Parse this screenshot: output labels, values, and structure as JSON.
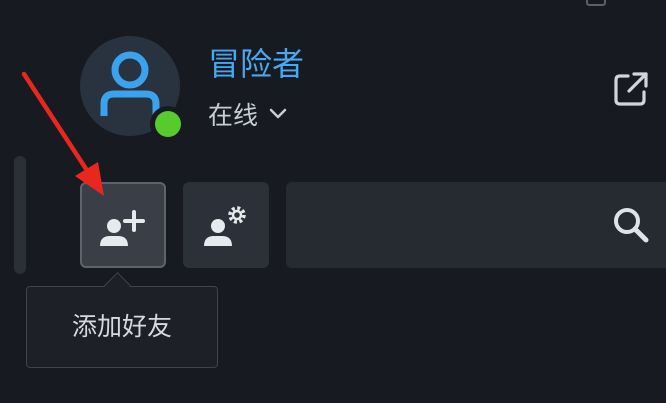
{
  "profile": {
    "username": "冒险者",
    "status_label": "在线"
  },
  "toolbar": {
    "add_friend_tooltip": "添加好友"
  },
  "search": {
    "value": "",
    "placeholder": ""
  },
  "colors": {
    "background": "#171a21",
    "username": "#47a9f2",
    "online_status": "#57cb2d",
    "avatar_figure": "#3ba3ee",
    "annotation_arrow": "#e8281f"
  },
  "icons": {
    "avatar": "user-icon",
    "status_toggle": "chevron-down-icon",
    "external": "external-link-icon",
    "add_friend": "user-plus-icon",
    "friend_settings": "user-gear-icon",
    "search": "search-icon"
  }
}
